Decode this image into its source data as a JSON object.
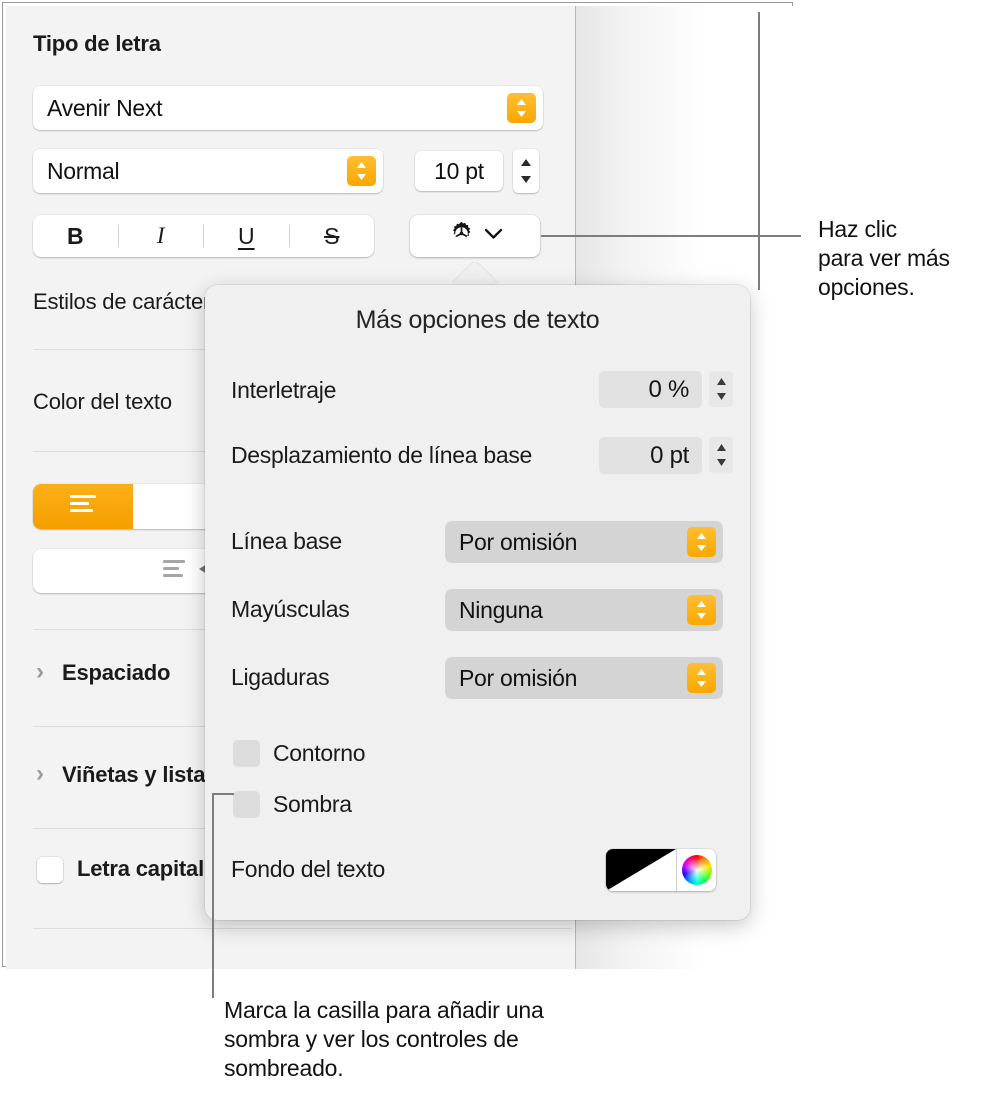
{
  "app": {
    "inspector_title": "Tipo de letra"
  },
  "font_section": {
    "family": {
      "value": "Avenir Next"
    },
    "style": {
      "value": "Normal"
    },
    "size": {
      "value": "10 pt"
    },
    "format_buttons": [
      {
        "name": "bold",
        "label": "B"
      },
      {
        "name": "italic",
        "label": "I"
      },
      {
        "name": "underline",
        "label": "U"
      },
      {
        "name": "strikethrough",
        "label": "S"
      }
    ]
  },
  "sidebar_rows": {
    "character_styles": "Estilos de carácter",
    "text_color": "Color del texto",
    "spacing": "Espaciado",
    "bullets_lists": "Viñetas y listas",
    "drop_cap": "Letra capital"
  },
  "popover": {
    "title": "Más opciones de texto",
    "rows": [
      {
        "name": "tracking",
        "label": "Interletraje",
        "value": "0 %"
      },
      {
        "name": "baseline-shift",
        "label": "Desplazamiento de línea base",
        "value": "0 pt"
      },
      {
        "name": "baseline",
        "label": "Línea base",
        "value": "Por omisión"
      },
      {
        "name": "capitalization",
        "label": "Mayúsculas",
        "value": "Ninguna"
      },
      {
        "name": "ligatures",
        "label": "Ligaduras",
        "value": "Por omisión"
      }
    ],
    "checkboxes": [
      {
        "name": "outline",
        "label": "Contorno",
        "checked": false
      },
      {
        "name": "shadow",
        "label": "Sombra",
        "checked": false
      }
    ],
    "text_background": {
      "label": "Fondo del texto"
    }
  },
  "callouts": {
    "top": {
      "line1": "Haz clic",
      "line2": "para ver más",
      "line3": "opciones."
    },
    "bottom": {
      "line1": "Marca la casilla para añadir una",
      "line2": "sombra y ver los controles de",
      "line3": "sombreado."
    }
  },
  "colors": {
    "accent_orange": "#f5a200",
    "panel_bg": "#f3f3f3",
    "popover_bg": "#f0f0f0",
    "field_grey": "#e1e1e1",
    "popup_grey": "#d4d4d4"
  },
  "icons": {
    "gear": "gear-icon",
    "chevron_down": "chevron-down-icon",
    "align_left": "align-left-icon",
    "align_justify": "align-justify-icon",
    "color_wheel": "color-wheel-icon"
  }
}
